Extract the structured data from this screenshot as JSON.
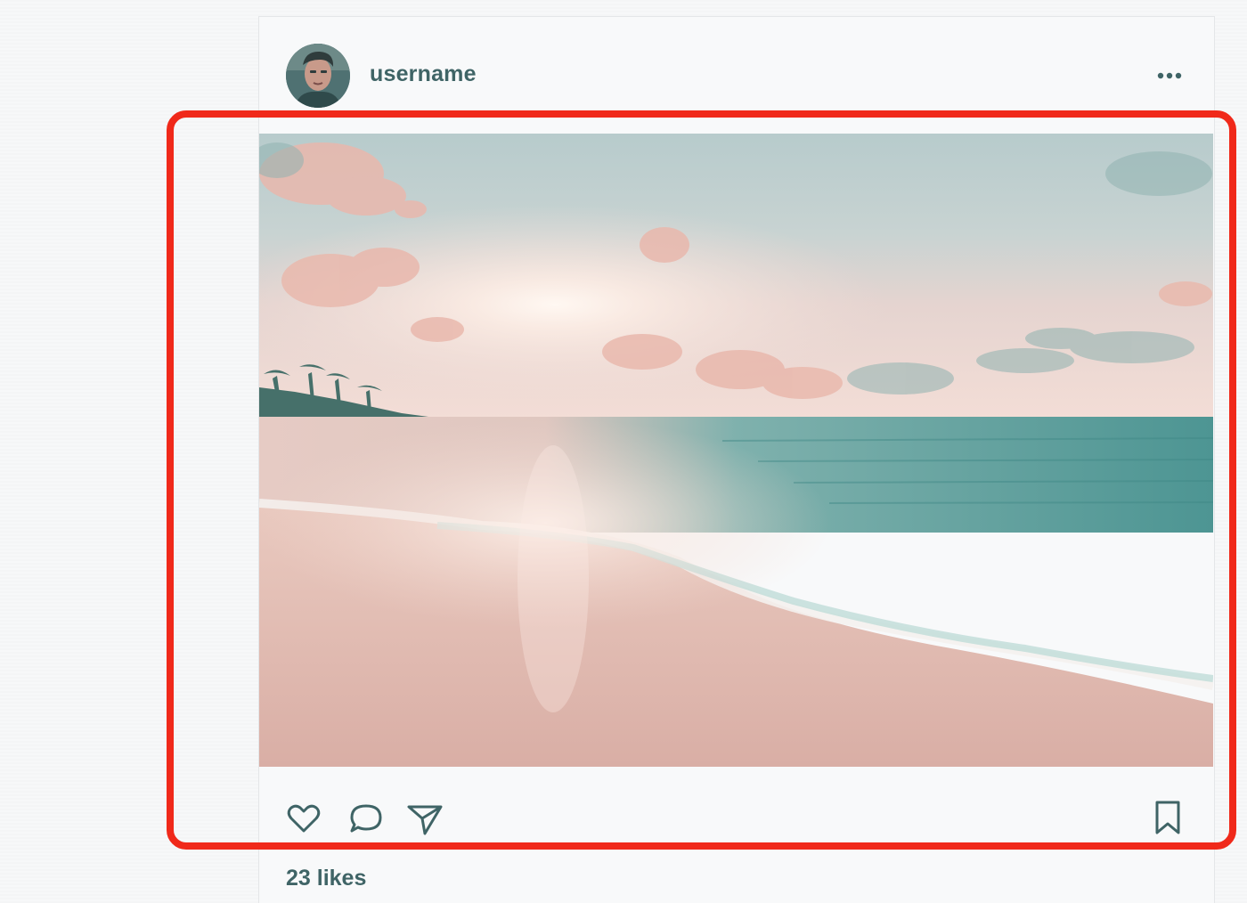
{
  "post": {
    "username": "username",
    "likes_text": "23 likes",
    "avatar_icon": "avatar",
    "image_icon": "beach-sunset-photo"
  },
  "header": {
    "more_icon": "more-horizontal-icon"
  },
  "actions": {
    "like_icon": "heart-icon",
    "comment_icon": "comment-icon",
    "share_icon": "send-icon",
    "save_icon": "bookmark-icon"
  },
  "colors": {
    "text": "#3f6466",
    "highlight": "#f0291a",
    "icon": "#3f6466"
  }
}
